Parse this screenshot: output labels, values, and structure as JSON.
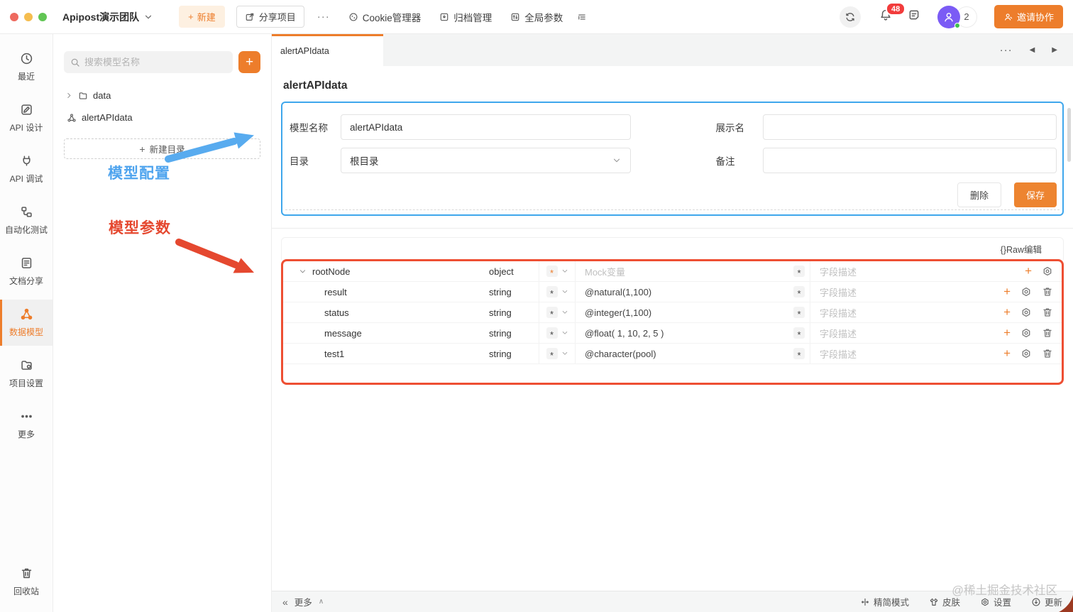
{
  "colors": {
    "accent_orange": "#ED7D2B",
    "config_box_border": "#3FA7EC",
    "params_box_border": "#EE4F33",
    "annotation_blue": "#4FA4EE",
    "annotation_red": "#E5482F",
    "avatar_purple": "#7B5BF5",
    "badge_red": "#F23C3C"
  },
  "icons": {
    "more_h": "···",
    "prev": "◀",
    "next": "▶",
    "collapse": "«",
    "caret_up": "∧",
    "plus": "+",
    "asterisk": "*"
  },
  "topbar": {
    "team": "Apipost演示团队",
    "new": "新建",
    "share": "分享项目",
    "cookie": "Cookie管理器",
    "archive": "归档管理",
    "global_params": "全局参数",
    "notification_count": "48",
    "member_count": "2",
    "invite": "邀请协作"
  },
  "sidebar": {
    "items": [
      {
        "label": "最近"
      },
      {
        "label": "API 设计"
      },
      {
        "label": "API 调试"
      },
      {
        "label": "自动化测试"
      },
      {
        "label": "文档分享"
      },
      {
        "label": "数据模型"
      },
      {
        "label": "项目设置"
      },
      {
        "label": "更多"
      }
    ],
    "recycle": "回收站"
  },
  "tree": {
    "search_placeholder": "搜索模型名称",
    "folder": "data",
    "model": "alertAPIdata",
    "new_dir": "新建目录"
  },
  "annotations": {
    "config": "模型配置",
    "params": "模型参数"
  },
  "main": {
    "tab": "alertAPIdata",
    "title": "alertAPIdata",
    "form": {
      "name_label": "模型名称",
      "name_value": "alertAPIdata",
      "display_label": "展示名",
      "display_value": "",
      "dir_label": "目录",
      "dir_value": "根目录",
      "remark_label": "备注",
      "remark_value": "",
      "delete": "删除",
      "save": "保存"
    },
    "raw_edit": "{}Raw编辑",
    "table": {
      "rows": [
        {
          "name": "rootNode",
          "type": "object",
          "mock_placeholder": "Mock变量",
          "mock_value": "",
          "desc_placeholder": "字段描述"
        },
        {
          "name": "result",
          "type": "string",
          "mock_value": "@natural(1,100)",
          "desc_placeholder": "字段描述"
        },
        {
          "name": "status",
          "type": "string",
          "mock_value": "@integer(1,100)",
          "desc_placeholder": "字段描述"
        },
        {
          "name": "message",
          "type": "string",
          "mock_value": "@float( 1, 10, 2, 5 )",
          "desc_placeholder": "字段描述"
        },
        {
          "name": "test1",
          "type": "string",
          "mock_value": "@character(pool)",
          "desc_placeholder": "字段描述"
        }
      ]
    },
    "footer": {
      "more": "更多",
      "compact": "精简模式",
      "skin": "皮肤",
      "settings": "设置",
      "update": "更新"
    }
  },
  "watermark": "@稀土掘金技术社区"
}
